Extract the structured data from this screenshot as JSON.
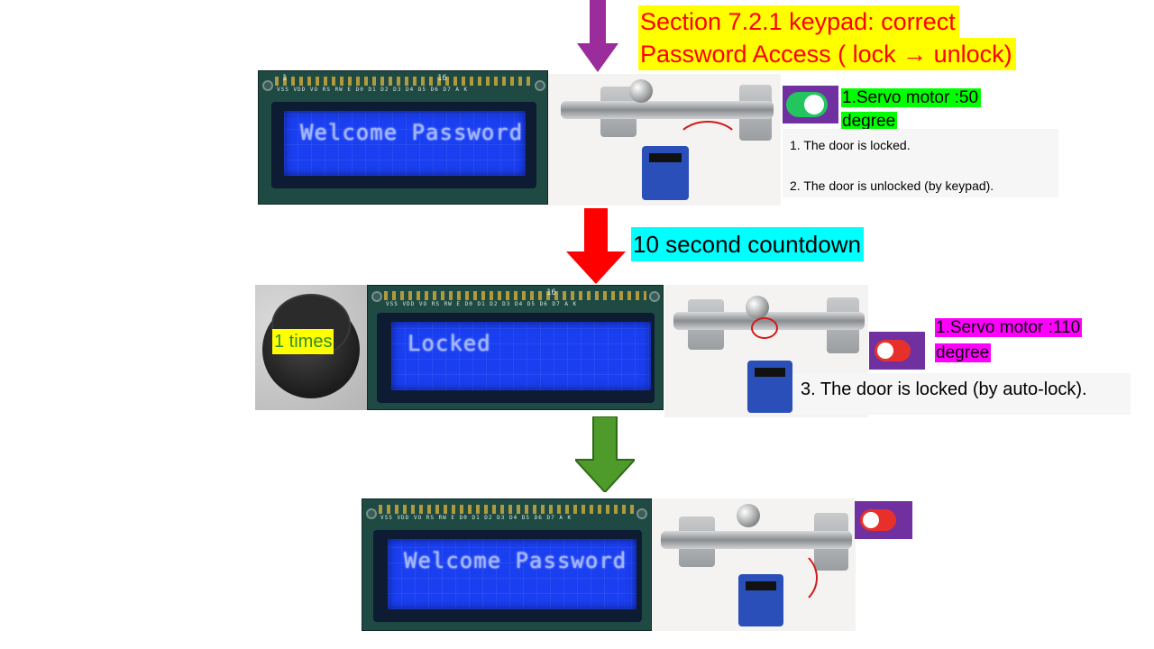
{
  "title": {
    "line1": "Section 7.2.1 keypad: correct",
    "line2": "Password Access ( lock → unlock)"
  },
  "step1": {
    "lcd_text": "Welcome Password",
    "servo_label_line1": "1.Servo motor :50",
    "servo_label_line2": "degree",
    "notes": [
      "1. The door is locked.",
      "2. The door is unlocked (by keypad)."
    ],
    "toggle_state": "on"
  },
  "countdown_label": "10 second countdown",
  "step2": {
    "buzzer_label": "1 times",
    "lcd_text": "Locked",
    "servo_label_line1": "1.Servo motor :110",
    "servo_label_line2": "degree",
    "note": "3. The door is locked (by auto-lock).",
    "toggle_state": "off"
  },
  "step3": {
    "lcd_text": "Welcome Password",
    "toggle_state": "off"
  },
  "lcd_pin_labels": "VSS VDD VO RS RW E D0 D1 D2 D3 D4 D5 D6 D7 A K",
  "lcd_pin_first": "1",
  "lcd_pin_last": "16",
  "colors": {
    "title_highlight": "#ffff00",
    "title_text": "#ff0000",
    "servo1_highlight": "#00ff00",
    "countdown_highlight": "#00ffff",
    "servo2_highlight": "#ff00ff",
    "toggle_box": "#7030a0",
    "toggle_on": "#22c55e",
    "toggle_off": "#e8302a",
    "arrow_purple": "#9b2c9b",
    "arrow_red": "#ff0000",
    "arrow_green": "#4e9a2a"
  }
}
